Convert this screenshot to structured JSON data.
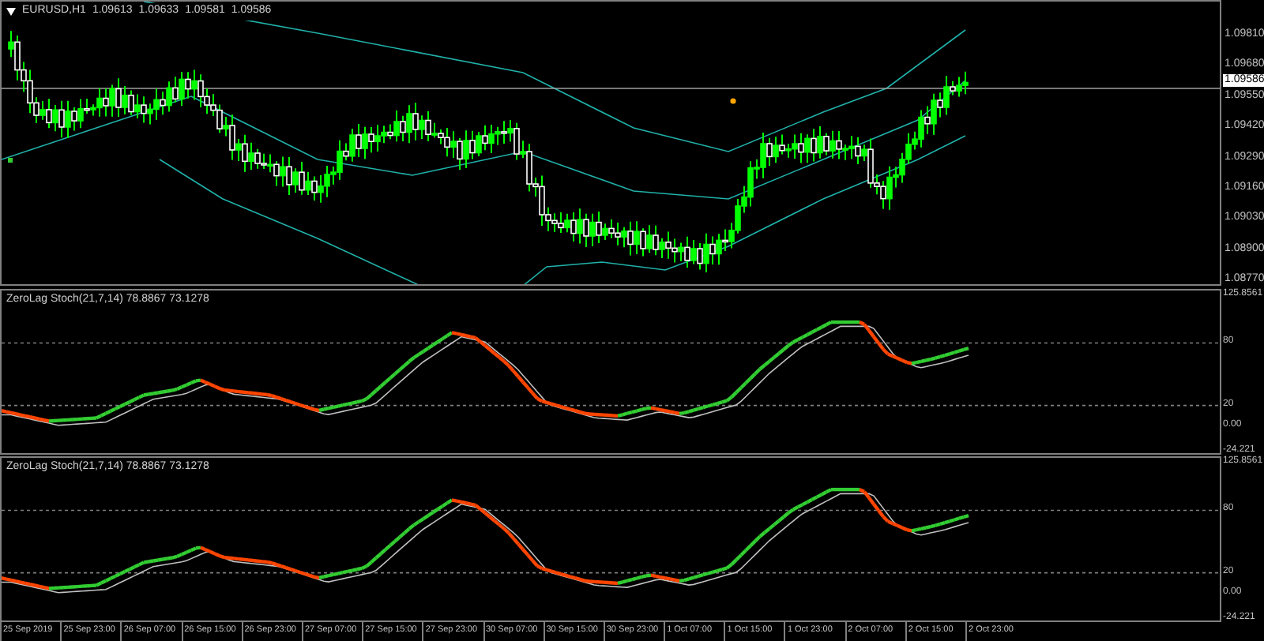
{
  "symbol_bar": {
    "symbol": "EURUSD,H1",
    "ohlc": [
      "1.09613",
      "1.09633",
      "1.09581",
      "1.09586"
    ]
  },
  "price_axis": {
    "labels": [
      "1.09810",
      "1.09680",
      "1.09550",
      "1.09420",
      "1.09290",
      "1.09160",
      "1.09030",
      "1.08900",
      "1.08770"
    ],
    "current_price": "1.09586"
  },
  "indicator_panels": [
    {
      "title": "ZeroLag Stoch(21,7,14) 78.8867 73.1278",
      "axis_labels": [
        "125.8561",
        "80",
        "20",
        "0.00",
        "-24.221"
      ]
    },
    {
      "title": "ZeroLag Stoch(21,7,14) 78.8867 73.1278",
      "axis_labels": [
        "125.8561",
        "80",
        "20",
        "0.00",
        "-24.221"
      ]
    }
  ],
  "time_axis": {
    "labels": [
      "25 Sep 2019",
      "25 Sep 23:00",
      "26 Sep 07:00",
      "26 Sep 15:00",
      "26 Sep 23:00",
      "27 Sep 07:00",
      "27 Sep 15:00",
      "27 Sep 23:00",
      "30 Sep 07:00",
      "30 Sep 15:00",
      "30 Sep 23:00",
      "1 Oct 07:00",
      "1 Oct 15:00",
      "1 Oct 23:00",
      "2 Oct 07:00",
      "2 Oct 15:00",
      "2 Oct 23:00"
    ]
  }
}
